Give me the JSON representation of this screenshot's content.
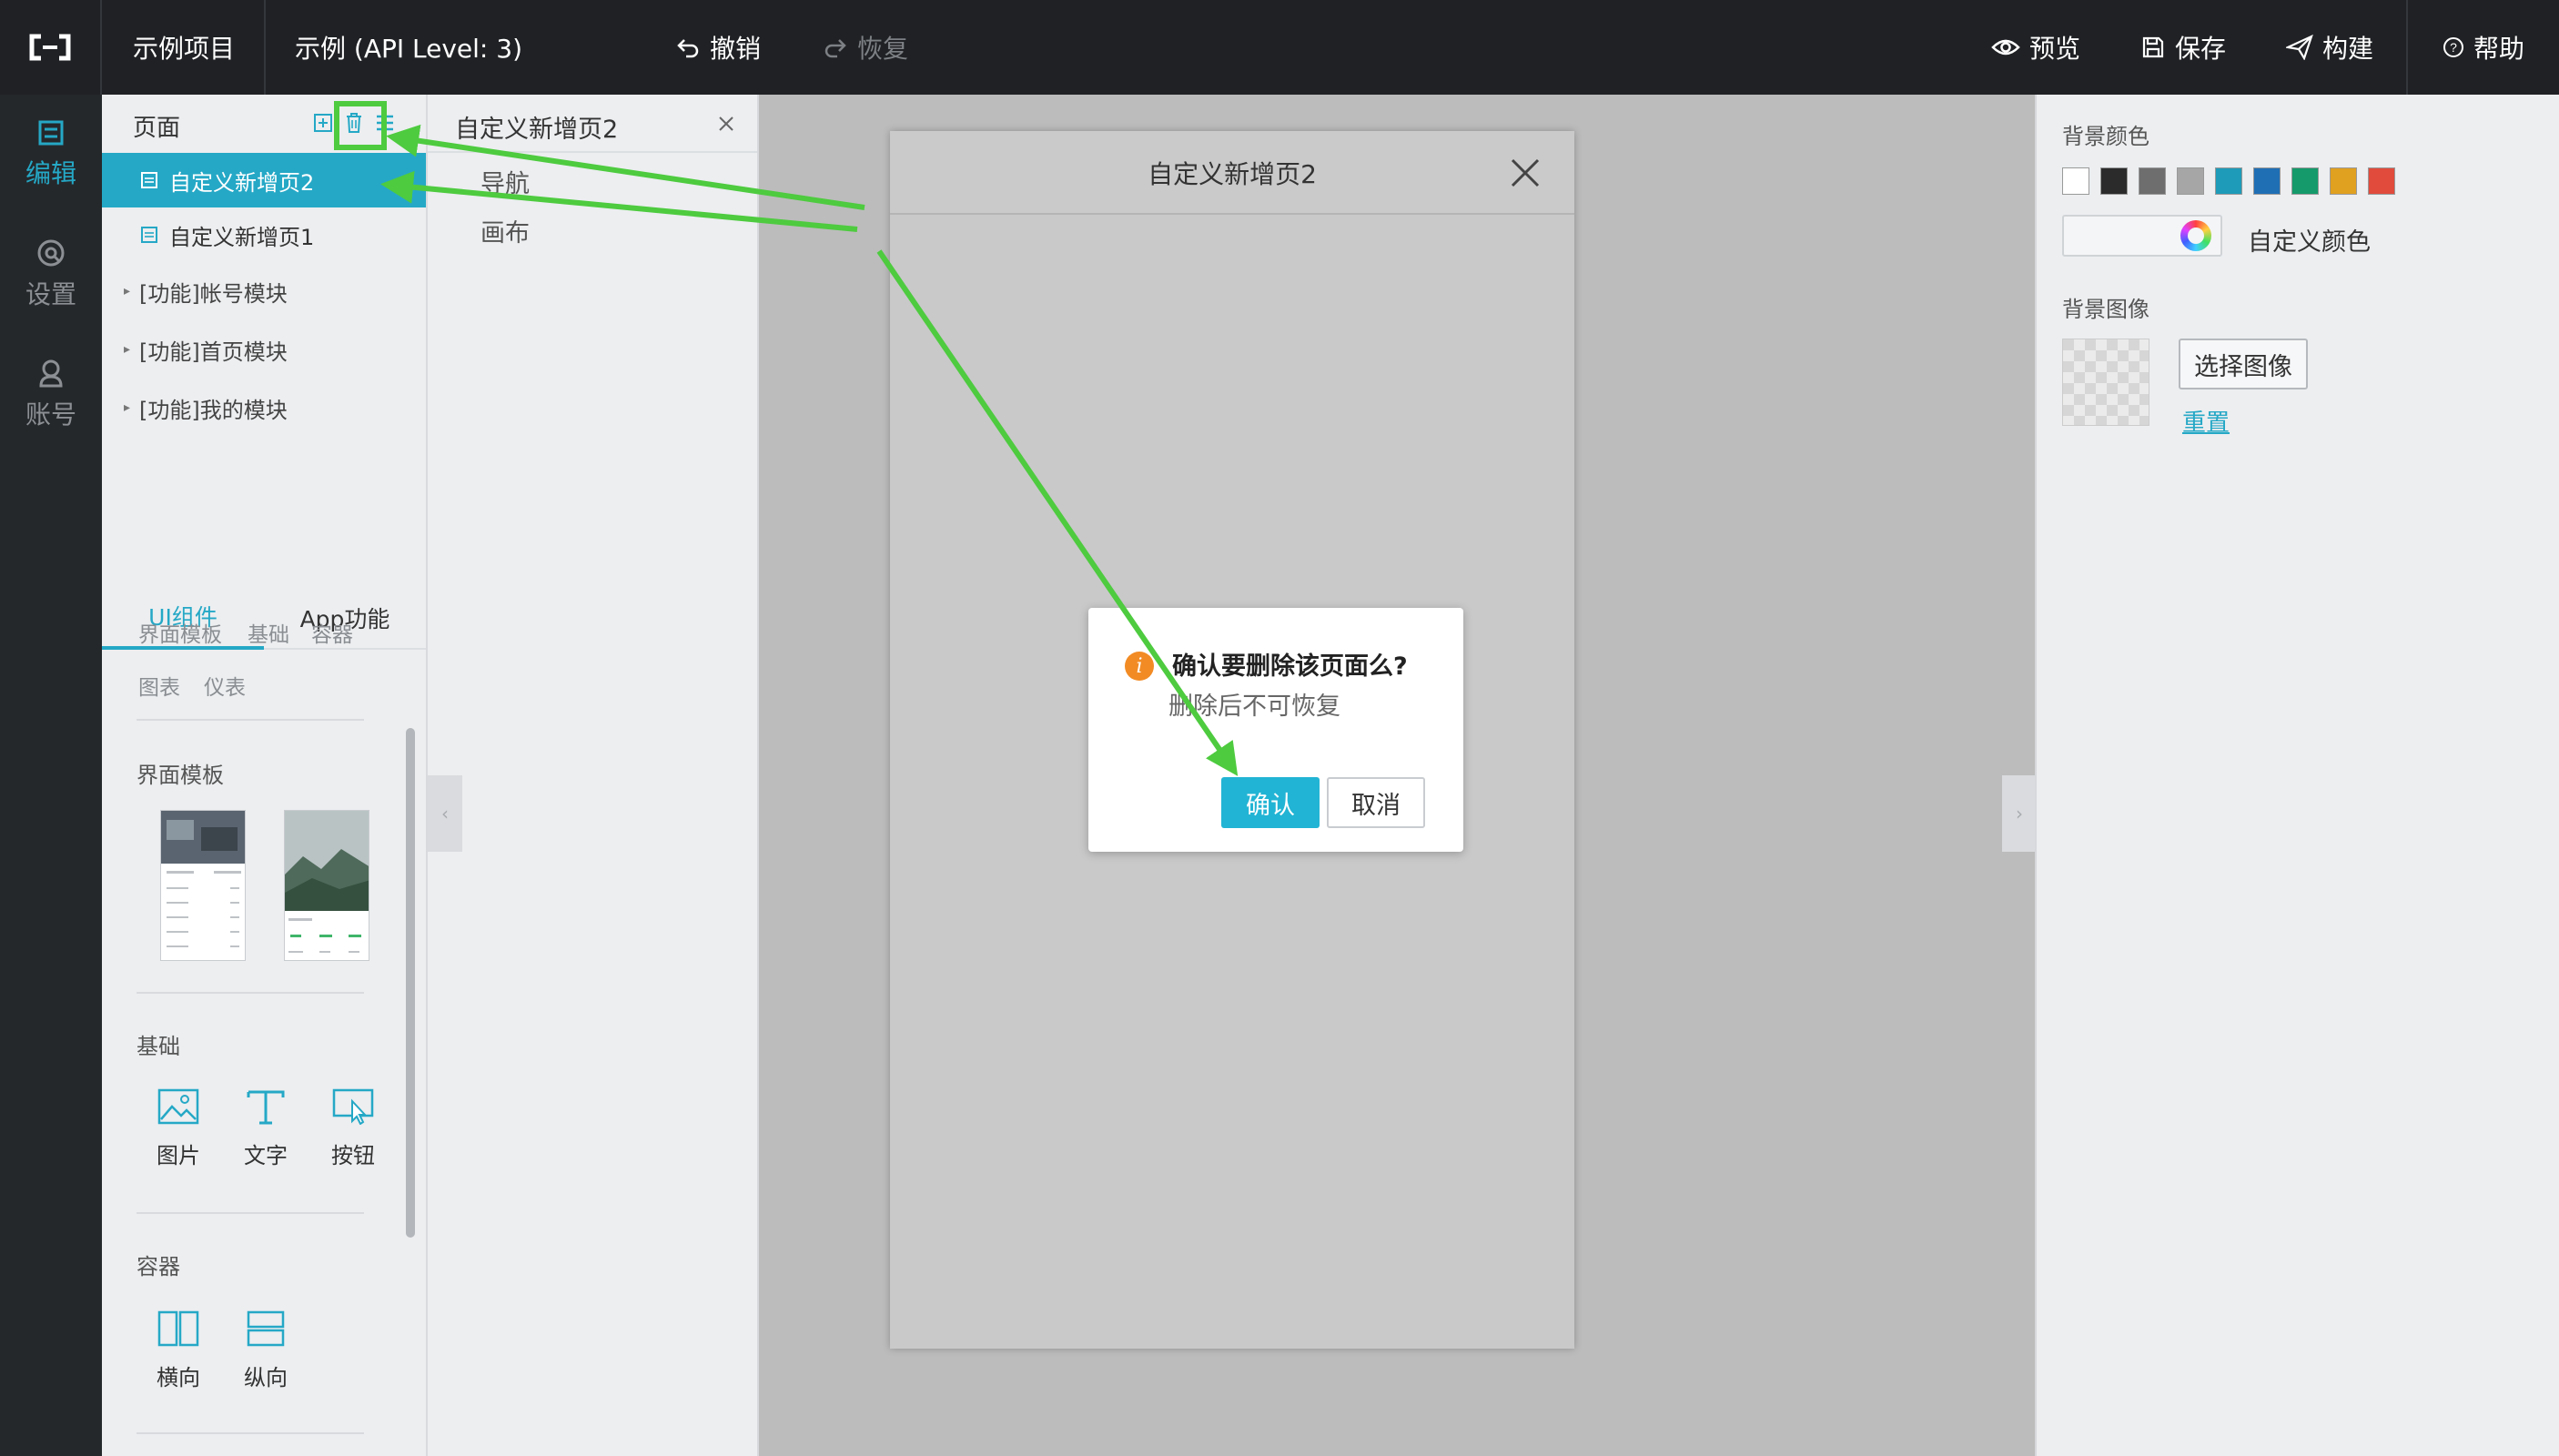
{
  "topbar": {
    "project": "示例项目",
    "app_name": "示例 (API Level: 3)",
    "undo": "撤销",
    "redo": "恢复",
    "preview": "预览",
    "save": "保存",
    "build": "构建",
    "help": "帮助"
  },
  "rail": {
    "items": [
      {
        "label": "编辑",
        "icon": "edit-icon",
        "active": true
      },
      {
        "label": "设置",
        "icon": "settings-icon",
        "active": false
      },
      {
        "label": "账号",
        "icon": "account-icon",
        "active": false
      }
    ]
  },
  "pages": {
    "title": "页面",
    "list": [
      {
        "label": "自定义新增页2",
        "selected": true
      },
      {
        "label": "自定义新增页1",
        "selected": false
      }
    ],
    "modules": [
      "[功能]帐号模块",
      "[功能]首页模块",
      "[功能]我的模块"
    ]
  },
  "components": {
    "tabs": [
      "UI组件",
      "App功能"
    ],
    "categories": [
      "界面模板",
      "基础",
      "容器",
      "图表",
      "仪表"
    ],
    "sections": {
      "templates": "界面模板",
      "basic": "基础",
      "container": "容器"
    },
    "basic_items": [
      "图片",
      "文字",
      "按钮"
    ],
    "container_items": [
      "横向",
      "纵向"
    ]
  },
  "outline": {
    "title": "自定义新增页2",
    "items": [
      "导航",
      "画布"
    ]
  },
  "canvas": {
    "page_title": "自定义新增页2"
  },
  "dialog": {
    "title": "确认要删除该页面么?",
    "message": "删除后不可恢复",
    "confirm": "确认",
    "cancel": "取消"
  },
  "props": {
    "bg_color_label": "背景颜色",
    "swatches": [
      "#ffffff",
      "#2b2b2b",
      "#6e6e6e",
      "#a6a6a6",
      "#1e9bb8",
      "#1f6fb5",
      "#159a6b",
      "#e0a020",
      "#e04b3c"
    ],
    "custom_color": "自定义颜色",
    "bg_image_label": "背景图像",
    "select_image": "选择图像",
    "reset": "重置"
  },
  "colors": {
    "accent": "#25a8c6",
    "annotation": "#4ecb3f",
    "warning": "#f28b24"
  }
}
